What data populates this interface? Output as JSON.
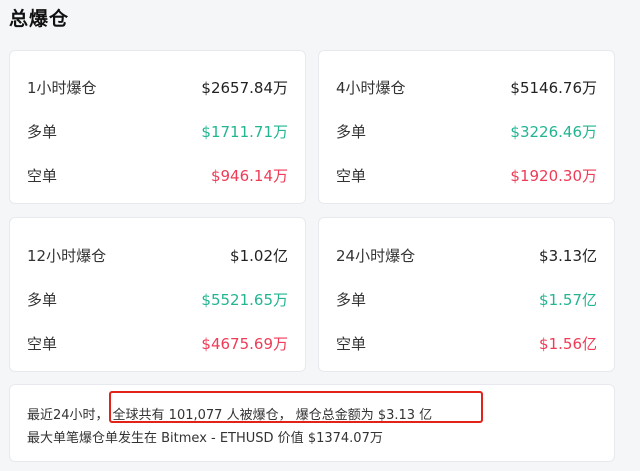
{
  "title": "总爆仓",
  "cards": [
    {
      "period": "1小时爆仓",
      "total": "$2657.84万",
      "long_label": "多单",
      "long_value": "$1711.71万",
      "short_label": "空单",
      "short_value": "$946.14万"
    },
    {
      "period": "4小时爆仓",
      "total": "$5146.76万",
      "long_label": "多单",
      "long_value": "$3226.46万",
      "short_label": "空单",
      "short_value": "$1920.30万"
    },
    {
      "period": "12小时爆仓",
      "total": "$1.02亿",
      "long_label": "多单",
      "long_value": "$5521.65万",
      "short_label": "空单",
      "short_value": "$4675.69万"
    },
    {
      "period": "24小时爆仓",
      "total": "$3.13亿",
      "long_label": "多单",
      "long_value": "$1.57亿",
      "short_label": "空单",
      "short_value": "$1.56亿"
    }
  ],
  "summary": {
    "line1_prefix": "最近24小时，",
    "line1_highlight": "全球共有 101,077 人被爆仓， 爆仓总金额为 $3.13 亿",
    "line2": "最大单笔爆仓单发生在 Bitmex - ETHUSD 价值 $1374.07万"
  },
  "colors": {
    "long": "#23b592",
    "short": "#ef3b57",
    "highlight_border": "#e2231a"
  }
}
